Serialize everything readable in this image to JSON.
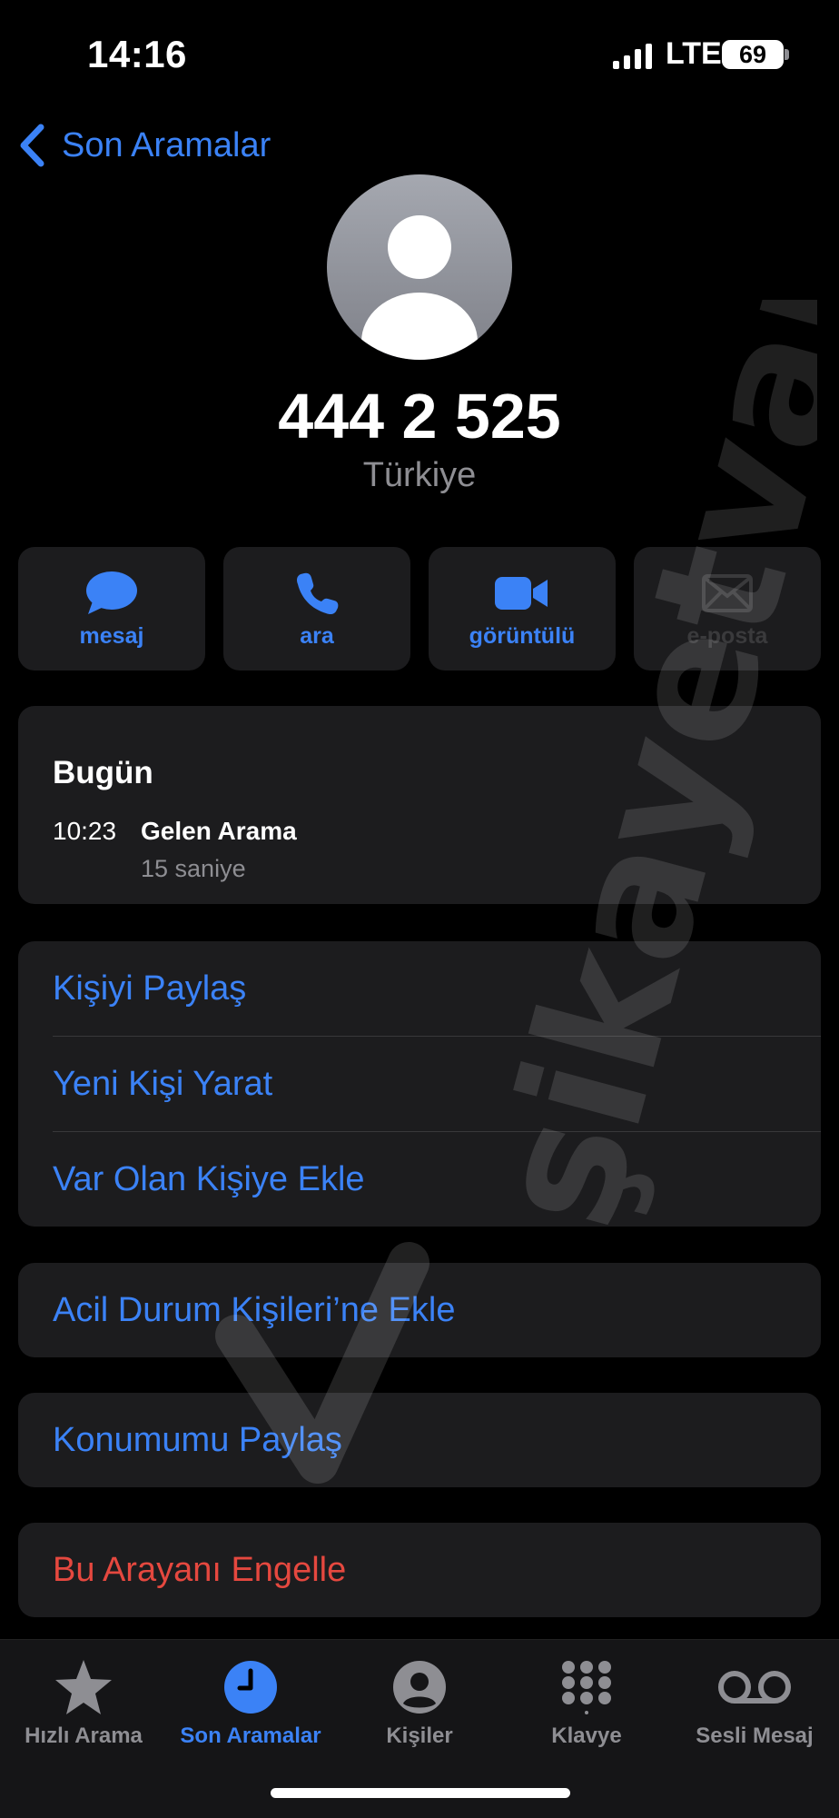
{
  "status_bar": {
    "time": "14:16",
    "network": "LTE",
    "battery": "69"
  },
  "nav": {
    "back_label": "Son Aramalar"
  },
  "contact": {
    "number": "444 2 525",
    "country": "Türkiye"
  },
  "actions": [
    {
      "label": "mesaj",
      "icon": "message-bubble-icon",
      "enabled": true
    },
    {
      "label": "ara",
      "icon": "phone-icon",
      "enabled": true
    },
    {
      "label": "görüntülü",
      "icon": "video-camera-icon",
      "enabled": true
    },
    {
      "label": "e-posta",
      "icon": "envelope-icon",
      "enabled": false
    }
  ],
  "recents": {
    "day": "Bugün",
    "entries": [
      {
        "time": "10:23",
        "type": "Gelen Arama",
        "duration": "15 saniye"
      }
    ]
  },
  "contact_options": [
    "Kişiyi Paylaş",
    "Yeni Kişi Yarat",
    "Var Olan Kişiye Ekle"
  ],
  "emergency": "Acil Durum Kişileri’ne Ekle",
  "share_location": "Konumumu Paylaş",
  "block": "Bu Arayanı Engelle",
  "tabs": [
    {
      "label": "Hızlı Arama",
      "icon": "star-icon",
      "active": false
    },
    {
      "label": "Son Aramalar",
      "icon": "clock-icon",
      "active": true
    },
    {
      "label": "Kişiler",
      "icon": "person-circle-icon",
      "active": false
    },
    {
      "label": "Klavye",
      "icon": "keypad-icon",
      "active": false
    },
    {
      "label": "Sesli Mesaj",
      "icon": "voicemail-icon",
      "active": false
    }
  ],
  "watermark": "şikayetvar",
  "colors": {
    "accent": "#3b82f6",
    "destructive": "#e5483f",
    "secondary_text": "#8e8e93",
    "card": "#1c1c1e"
  }
}
